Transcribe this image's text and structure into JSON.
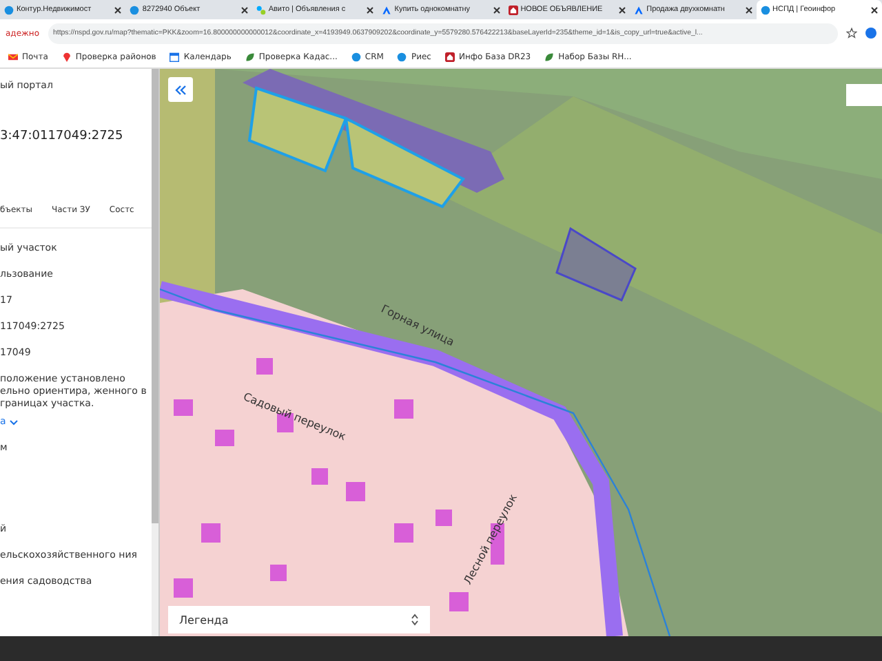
{
  "browser": {
    "tabs": [
      {
        "title": "Контур.Недвижимост",
        "selected": false
      },
      {
        "title": "8272940 Объект",
        "selected": false
      },
      {
        "title": "Авито | Объявления с",
        "selected": false
      },
      {
        "title": "Купить однокомнатну",
        "selected": false
      },
      {
        "title": "НОВОЕ ОБЪЯВЛЕНИЕ",
        "selected": false
      },
      {
        "title": "Продажа двухкомнатн",
        "selected": false
      },
      {
        "title": "НСПД | Геоинфор",
        "selected": true
      }
    ],
    "security": "адежно",
    "url": "https://nspd.gov.ru/map?thematic=PKK&zoom=16.800000000000012&coordinate_x=4193949.0637909202&coordinate_y=5579280.576422213&baseLayerId=235&theme_id=1&is_copy_url=true&active_l...",
    "bookmarks": [
      {
        "label": "Почта"
      },
      {
        "label": "Проверка районов"
      },
      {
        "label": "Календарь"
      },
      {
        "label": "Проверка Кадас..."
      },
      {
        "label": "CRM"
      },
      {
        "label": "Риес"
      },
      {
        "label": "Инфо База DR23"
      },
      {
        "label": "Набор Базы RH..."
      }
    ]
  },
  "panel": {
    "portal": "ый портал",
    "cadastral_number": "3:47:0117049:2725",
    "tabs": [
      "бъекты",
      "Части ЗУ",
      "Состс"
    ],
    "fields": [
      {
        "kind": "text",
        "text": "ый участок"
      },
      {
        "kind": "text",
        "text": "льзование"
      },
      {
        "kind": "text",
        "text": "17"
      },
      {
        "kind": "text",
        "text": "117049:2725"
      },
      {
        "kind": "text",
        "text": "17049"
      },
      {
        "kind": "text",
        "text": "положение установлено ельно ориентира, женного в границах участка."
      },
      {
        "kind": "link",
        "text": "а"
      },
      {
        "kind": "text",
        "text": "м"
      },
      {
        "kind": "gap"
      },
      {
        "kind": "text",
        "text": "й"
      },
      {
        "kind": "text",
        "text": "ельскохозяйственного ния"
      },
      {
        "kind": "text",
        "text": "ения садоводства"
      }
    ]
  },
  "map": {
    "streets": [
      "Горная улица",
      "Садовый переулок",
      "Лесной переулок"
    ],
    "legend": "Легенда"
  }
}
